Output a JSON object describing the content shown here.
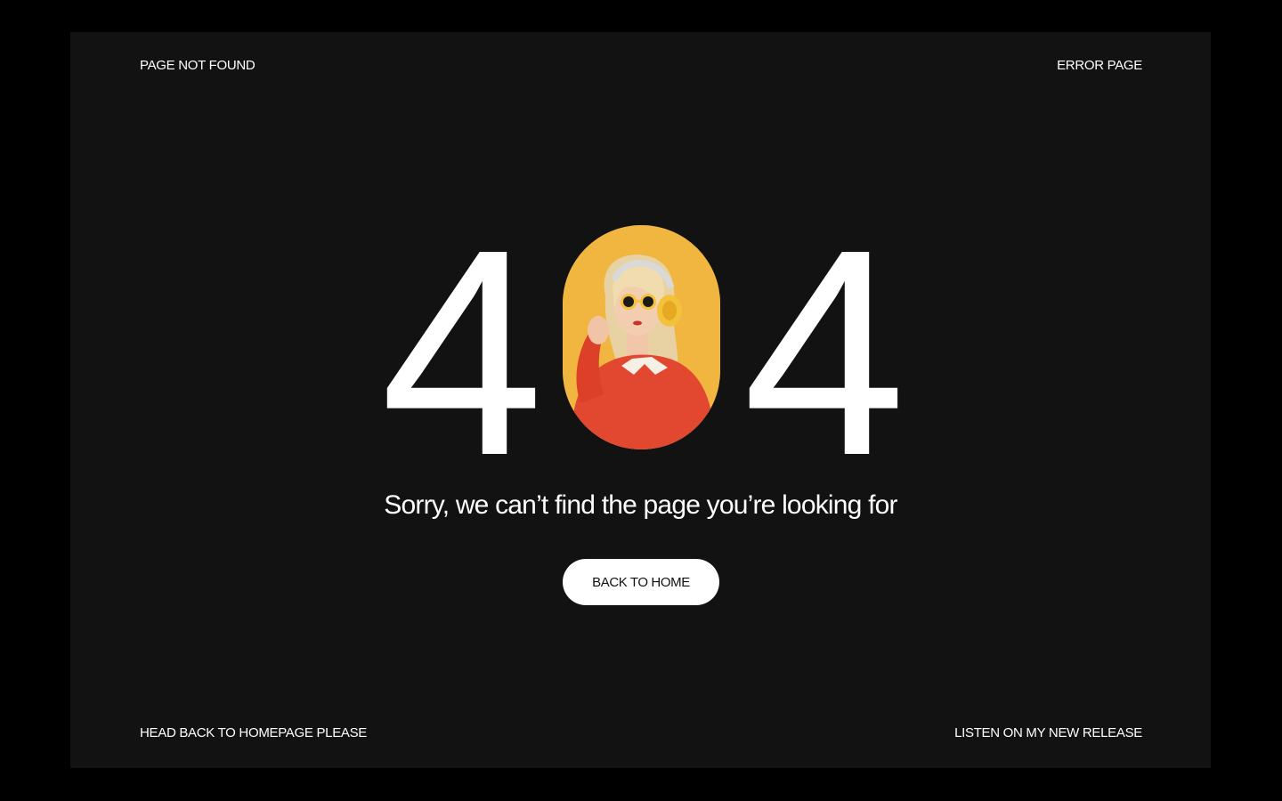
{
  "header": {
    "left_label": "PAGE NOT FOUND",
    "right_label": "ERROR PAGE"
  },
  "hero": {
    "digit_left": "4",
    "digit_right": "4",
    "zero_image": "woman-with-headphones-photo",
    "message": "Sorry, we can’t find the page you’re looking for"
  },
  "cta": {
    "label": "BACK TO HOME"
  },
  "footer": {
    "left_label": "HEAD BACK TO HOMEPAGE PLEASE",
    "right_label": "LISTEN ON MY NEW RELEASE"
  },
  "colors": {
    "page_bg": "#000000",
    "frame_bg": "#121212",
    "text": "#ffffff",
    "accent_yellow": "#f0b43c",
    "button_bg": "#ffffff"
  }
}
